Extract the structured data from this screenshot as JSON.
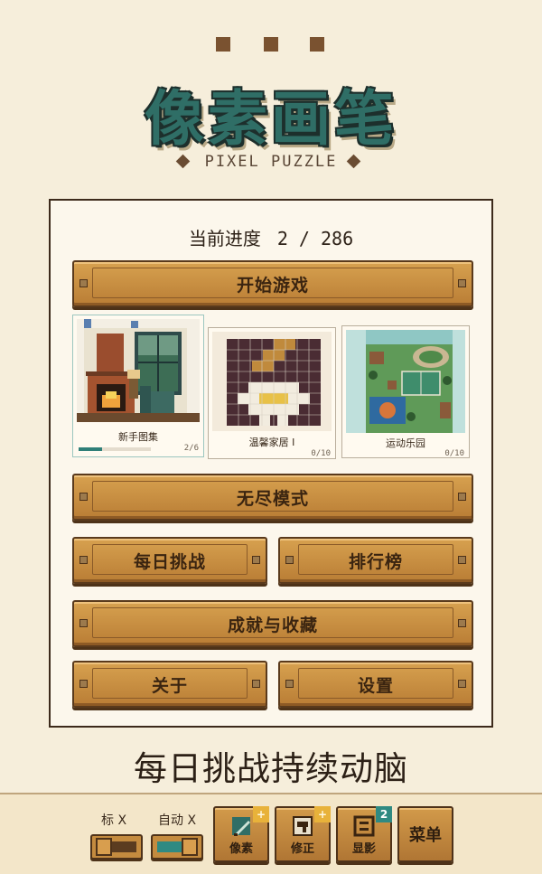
{
  "app": {
    "title": "像素画笔",
    "subtitle": "PIXEL PUZZLE"
  },
  "progress": {
    "label": "当前进度",
    "value": "2 / 286"
  },
  "buttons": {
    "start": "开始游戏",
    "endless": "无尽模式",
    "daily": "每日挑战",
    "leaderboard": "排行榜",
    "achievements": "成就与收藏",
    "about": "关于",
    "settings": "设置"
  },
  "collections": [
    {
      "name": "新手图集",
      "count": "2/6",
      "progress": 0.33
    },
    {
      "name": "温馨家居 I",
      "count": "0/10",
      "progress": 0
    },
    {
      "name": "运动乐园",
      "count": "0/10",
      "progress": 0
    }
  ],
  "slogan": "每日挑战持续动脑",
  "toolbar": {
    "toggle_mark": "标 X",
    "toggle_auto": "自动 X",
    "tools": [
      {
        "label": "像素",
        "icon": "pencil-icon",
        "badge": "+"
      },
      {
        "label": "修正",
        "icon": "eraser-icon",
        "badge": "+"
      },
      {
        "label": "显影",
        "icon": "reveal-icon",
        "badge": "2"
      }
    ],
    "menu": "菜单"
  },
  "colors": {
    "accent": "#2f8a82",
    "wood": "#c48b3f",
    "background": "#f6eedb"
  }
}
